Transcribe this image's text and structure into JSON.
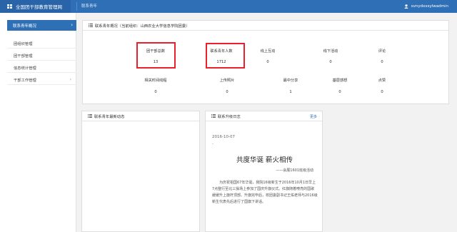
{
  "header": {
    "title": "全国团干部教育管理网",
    "nav_link": "联系青年",
    "user": "svnydxxsylwadmin"
  },
  "sidebar": {
    "active": "联系青年概况",
    "items": [
      {
        "label": "团组织管理"
      },
      {
        "label": "团干部管理"
      },
      {
        "label": "信息统计管理"
      },
      {
        "label": "干部工作管理"
      }
    ]
  },
  "overview": {
    "title": "联系青年概况（当前组织：山西农业大学信息学院团委）",
    "row1": [
      {
        "label": "团干部总数",
        "value": "13"
      },
      {
        "label": "联系青年人数",
        "value": "1712"
      },
      {
        "label": "线上互动",
        "value": "0"
      },
      {
        "label": "线下活动",
        "value": "0"
      },
      {
        "label": "评论",
        "value": "0"
      }
    ],
    "row2": [
      {
        "label": "相关时间线程",
        "value": "0"
      },
      {
        "label": "上传照片",
        "value": "0"
      },
      {
        "label": "最中分享",
        "value": "1"
      },
      {
        "label": "基层感想",
        "value": "0"
      },
      {
        "label": "点赞",
        "value": "0"
      }
    ]
  },
  "dynamics": {
    "title": "联系青年最新动态"
  },
  "news": {
    "title": "联系升级日志",
    "more": "更多",
    "date": "2016-10-07",
    "dash": "-",
    "headline": "共度华诞  薪火相传",
    "sub": "——会展1601班级活动",
    "body": "为庆祝祖国67年华诞，我院16级新生于2016年10月1日早上7点整行至北三操场上参加了国庆升旗仪式。红旗随着嘹亮的国歌缓缓升上旗杆顶部。升旗完毕后，校团委副书记王佑老师与2016级新生代表先后进行了国旗下讲话。"
  },
  "colors": {
    "primary": "#2f6fb6",
    "highlight": "#e8212c"
  }
}
